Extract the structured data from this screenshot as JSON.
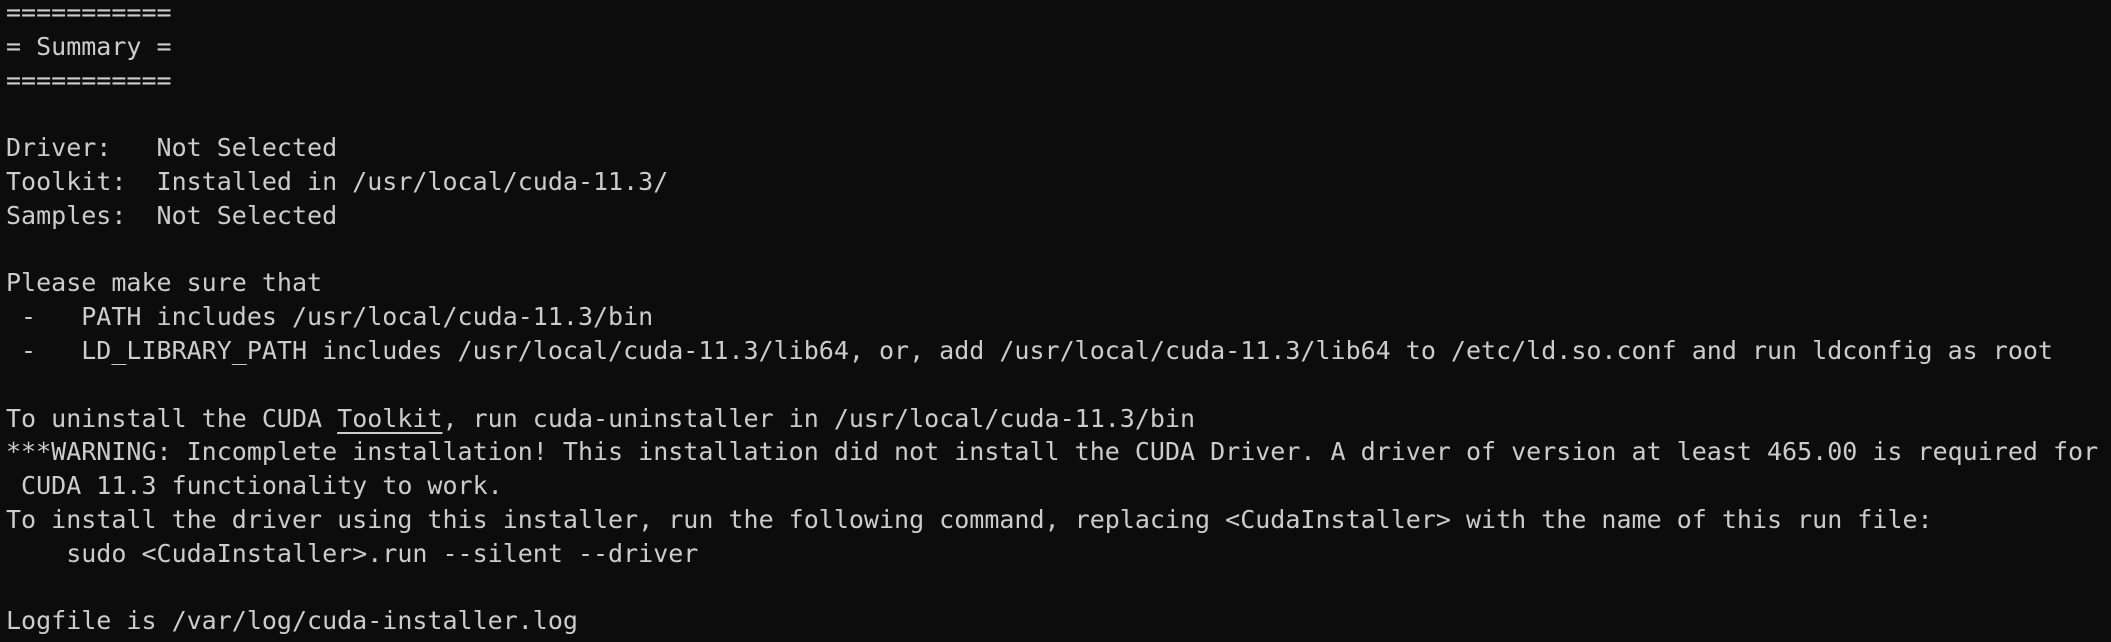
{
  "terminal": {
    "lines": {
      "sep1": "===========",
      "title": "= Summary =",
      "sep2": "===========",
      "blank1": "",
      "driver": "Driver:   Not Selected",
      "toolkit": "Toolkit:  Installed in /usr/local/cuda-11.3/",
      "samples": "Samples:  Not Selected",
      "blank2": "",
      "make_sure": "Please make sure that",
      "path_item": " -   PATH includes /usr/local/cuda-11.3/bin",
      "ld_item": " -   LD_LIBRARY_PATH includes /usr/local/cuda-11.3/lib64, or, add /usr/local/cuda-11.3/lib64 to /etc/ld.so.conf and run ldconfig as root",
      "blank3": "",
      "uninstall_pre": "To uninstall the CUDA ",
      "uninstall_link": "Toolkit",
      "uninstall_post": ", run cuda-uninstaller in /usr/local/cuda-11.3/bin",
      "warning": "***WARNING: Incomplete installation! This installation did not install the CUDA Driver. A driver of version at least 465.00 is required for",
      "warning_cont": " CUDA 11.3 functionality to work.",
      "install_driver": "To install the driver using this installer, run the following command, replacing <CudaInstaller> with the name of this run file:",
      "command": "    sudo <CudaInstaller>.run --silent --driver",
      "blank4": "",
      "logfile": "Logfile is /var/log/cuda-installer.log"
    }
  }
}
